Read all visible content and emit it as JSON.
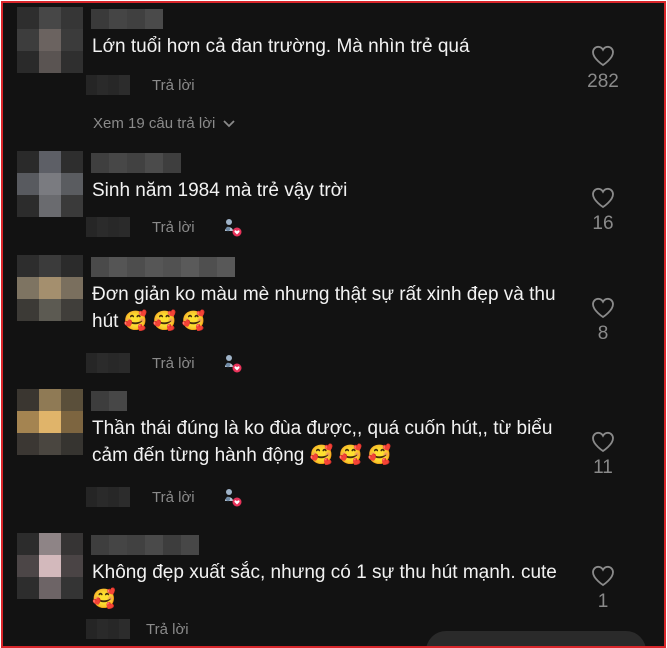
{
  "comments": [
    {
      "text": "Lớn tuổi hơn cả đan trường. Mà nhìn trẻ quá",
      "reply_label": "Trả lời",
      "likes": "282",
      "view_replies": "Xem 19 câu trả lời",
      "avatar_colors": [
        "#2e2e2e",
        "#474747",
        "#363636",
        "#3d3d3d",
        "#6b6360",
        "#3b3b3b",
        "#2a2a2a",
        "#5a5452",
        "#2f2f2f"
      ],
      "username_colors": [
        "#3a3a3a",
        "#454545",
        "#404040",
        "#4a4a4a"
      ],
      "time_colors": [
        "#252525",
        "#2a2a2a",
        "#272727",
        "#2c2c2c"
      ]
    },
    {
      "text": "Sinh năm 1984 mà trẻ vậy trời",
      "reply_label": "Trả lời",
      "likes": "16",
      "avatar_colors": [
        "#2a2a2a",
        "#5d5f66",
        "#2e2e2e",
        "#585a5f",
        "#7a7b80",
        "#5a5c60",
        "#2c2c2c",
        "#6a6b6f",
        "#3a3a3a"
      ],
      "username_colors": [
        "#3f3f3f",
        "#474747",
        "#414141",
        "#4b4b4b",
        "#3e3e3e"
      ],
      "time_colors": [
        "#262626",
        "#2b2b2b",
        "#282828",
        "#2a2a2a"
      ]
    },
    {
      "text": "Đơn giản ko màu mè nhưng thật sự rất xinh đẹp và thu hút 🥰 🥰 🥰",
      "reply_label": "Trả lời",
      "likes": "8",
      "avatar_colors": [
        "#2d2d2d",
        "#3b3b3b",
        "#2b2b2b",
        "#7e7462",
        "#a48f6e",
        "#7a6f5e",
        "#3c3a36",
        "#5c5a52",
        "#403e3a"
      ],
      "username_colors": [
        "#4a4a4a",
        "#555555",
        "#4d4d4d",
        "#565656",
        "#515151",
        "#5a5a5a",
        "#4f4f4f",
        "#585858"
      ],
      "time_colors": [
        "#262626",
        "#2b2b2b",
        "#282828",
        "#2a2a2a"
      ]
    },
    {
      "text": "Thần thái đúng là ko đùa được,, quá cuốn hút,, từ biểu cảm đến từng hành động 🥰 🥰 🥰",
      "reply_label": "Trả lời",
      "likes": "11",
      "avatar_colors": [
        "#3a3630",
        "#8f7a55",
        "#5a4f3a",
        "#a48451",
        "#e0b46a",
        "#7d6540",
        "#3b3733",
        "#4a4640",
        "#363430"
      ],
      "username_colors": [
        "#3d3d3d",
        "#474747"
      ],
      "time_colors": [
        "#252525",
        "#2a2a2a",
        "#272727",
        "#2c2c2c"
      ]
    },
    {
      "text": "Không đẹp xuất sắc, nhưng có 1 sự thu hút mạnh. cute 🥰",
      "reply_label": "Trả lời",
      "likes": "1",
      "avatar_colors": [
        "#2c2c2c",
        "#8e8486",
        "#363434",
        "#4c4647",
        "#d3b9bc",
        "#4a4445",
        "#2d2d2d",
        "#6d6466",
        "#343434"
      ],
      "username_colors": [
        "#3e3e3e",
        "#454545",
        "#414141",
        "#4a4a4a",
        "#3d3d3d",
        "#474747"
      ],
      "time_colors": [
        "#252525",
        "#2a2a2a",
        "#272727",
        "#2c2c2c"
      ]
    }
  ],
  "colors": {
    "background": "#121212",
    "border": "#d9262b",
    "text": "#f2f2f2",
    "muted": "#8a8a8a"
  },
  "icons": {
    "like": "heart-outline-icon",
    "creator_like": "creator-liked-icon",
    "expand": "chevron-down-icon"
  }
}
